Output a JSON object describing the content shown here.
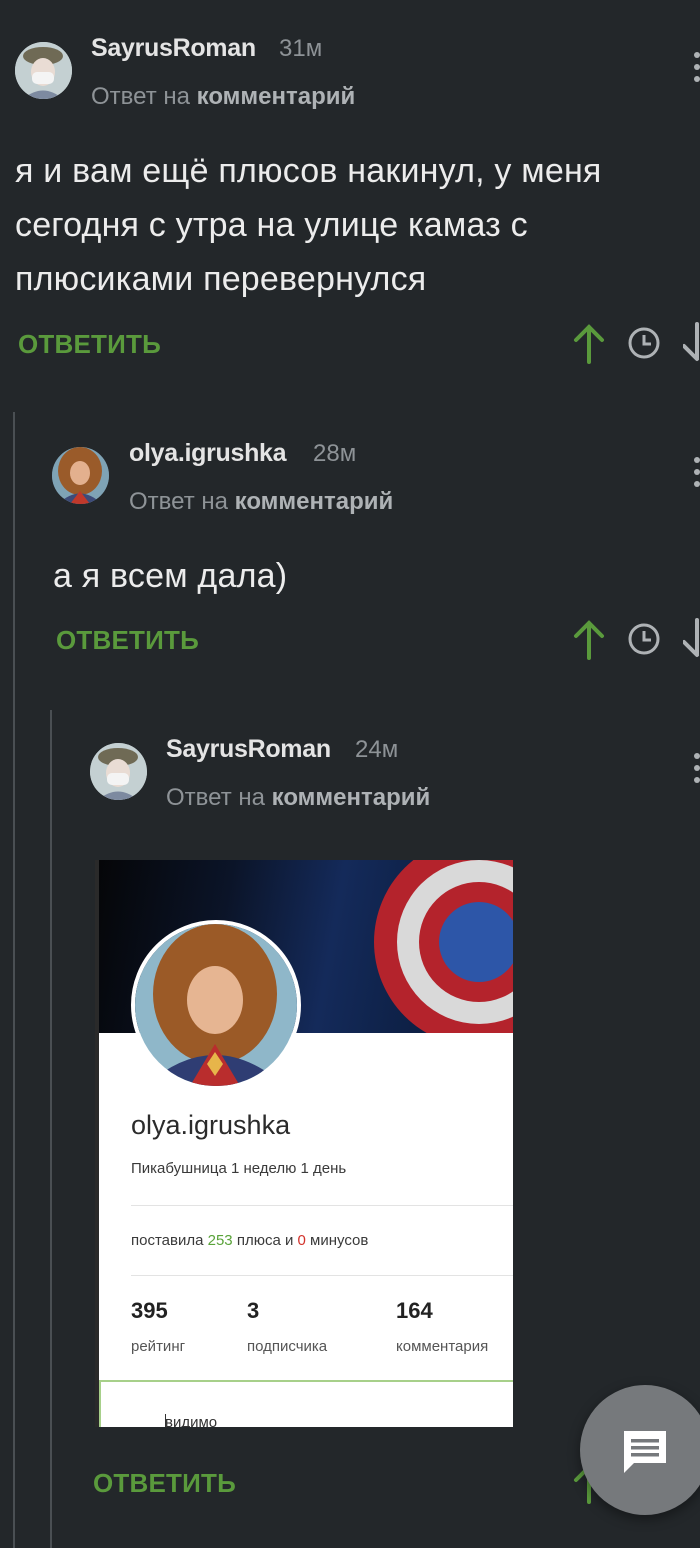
{
  "comments": [
    {
      "author": "SayrusRoman",
      "time": "31м",
      "reply_prefix": "Ответ на",
      "reply_target": "комментарий",
      "text": "я и вам ещё плюсов накинул, у меня сегодня с утра на улице камаз с плюсиками перевернулся",
      "reply_label": "ОТВЕТИТЬ"
    },
    {
      "author": "olya.igrushka",
      "time": "28м",
      "reply_prefix": "Ответ на",
      "reply_target": "комментарий",
      "text": "а я всем дала)",
      "reply_label": "ОТВЕТИТЬ"
    },
    {
      "author": "SayrusRoman",
      "time": "24м",
      "reply_prefix": "Ответ на",
      "reply_target": "комментарий",
      "reply_label": "ОТВЕТИТЬ"
    }
  ],
  "profile_image": {
    "username": "olya.igrushka",
    "subtitle": "Пикабушница 1 неделю 1 день",
    "votes_prefix": "поставила",
    "plus_count": "253",
    "votes_mid": "плюса и",
    "minus_count": "0",
    "votes_suffix": "минусов",
    "stats": [
      {
        "value": "395",
        "label": "рейтинг"
      },
      {
        "value": "3",
        "label": "подписчика"
      },
      {
        "value": "164",
        "label": "комментария"
      }
    ],
    "note_text": "видимо хороший человек"
  },
  "icons": {
    "upvote": "arrow-up-icon",
    "save": "clock-icon",
    "downvote": "arrow-down-icon",
    "more": "kebab-menu-icon",
    "fab": "comment-icon"
  },
  "colors": {
    "background": "#23272a",
    "accent_green": "#5a9a3c",
    "muted_text": "#8e9397"
  }
}
